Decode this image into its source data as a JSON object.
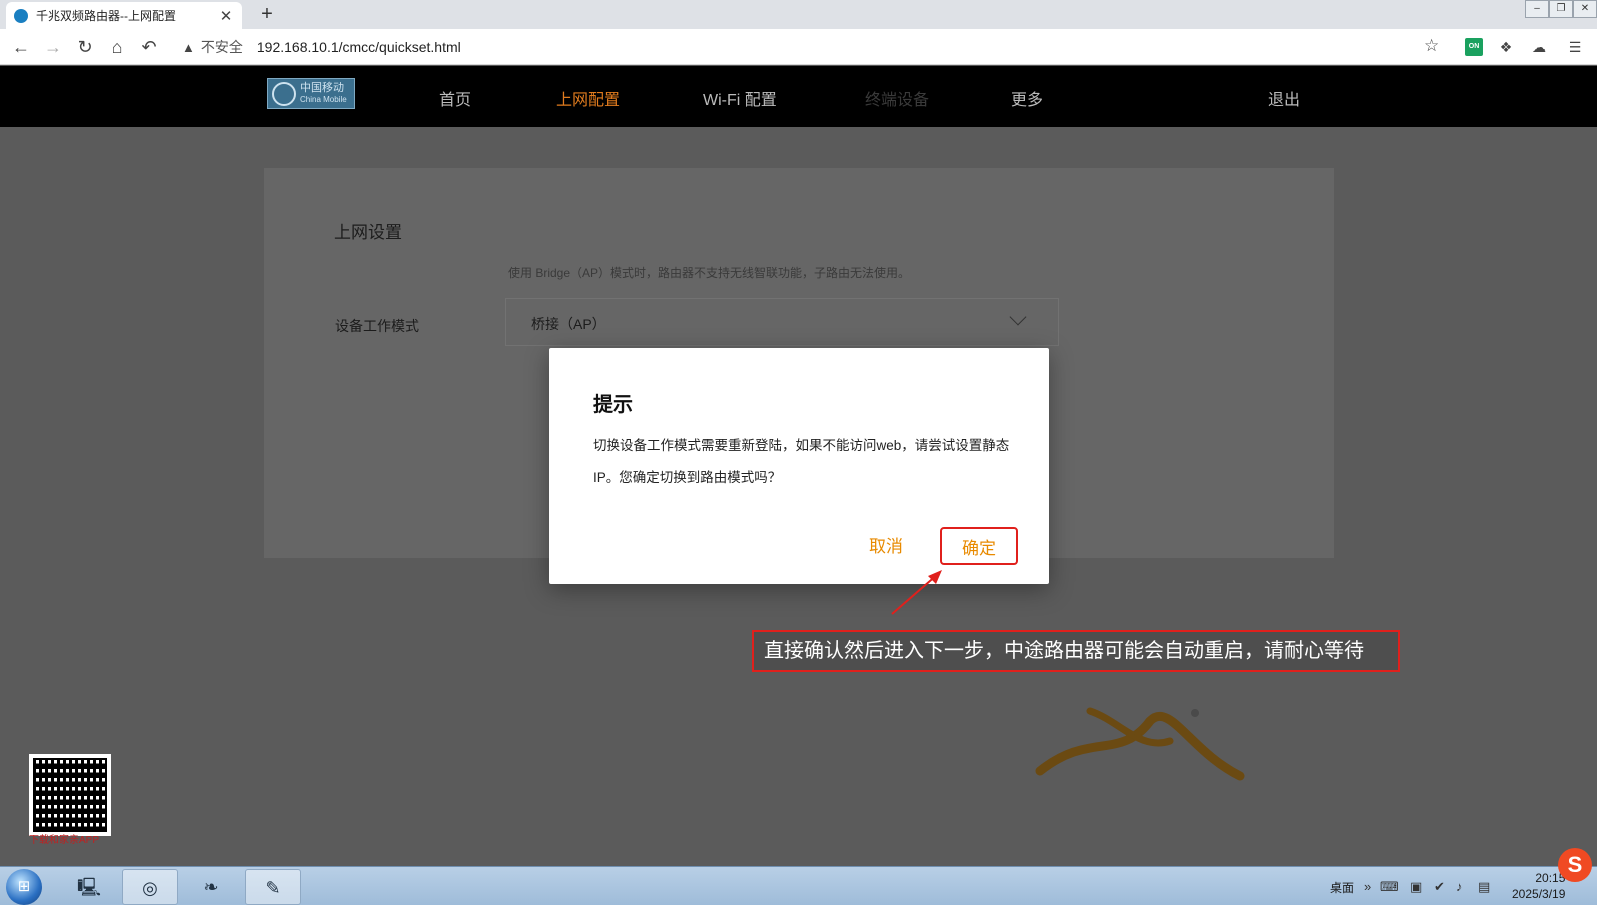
{
  "browser": {
    "tab_title": "千兆双频路由器--上网配置",
    "tab_close": "✕",
    "new_tab": "+",
    "security_label": "不安全",
    "url": "192.168.10.1/cmcc/quickset.html",
    "ext_on_label": "ON",
    "icons": [
      "back-icon",
      "forward-icon",
      "reload-icon",
      "home-icon",
      "undo-icon",
      "warning-icon",
      "star-icon",
      "extensions-icon",
      "download-icon",
      "menu-icon"
    ]
  },
  "router": {
    "logo_text": "中国移动",
    "logo_en": "China Mobile",
    "nav": [
      {
        "label": "首页"
      },
      {
        "label": "上网配置"
      },
      {
        "label": "Wi-Fi 配置"
      },
      {
        "label": "终端设备"
      },
      {
        "label": "更多"
      },
      {
        "label": "退出"
      }
    ],
    "active_nav": "上网配置",
    "section_title": "上网设置",
    "hint": "使用 Bridge（AP）模式时，路由器不支持无线智联功能，子路由无法使用。",
    "field_label": "设备工作模式",
    "select_value": "桥接（AP）",
    "qr_caption": "下载和家亲APP"
  },
  "modal": {
    "title": "提示",
    "message": "切换设备工作模式需要重新登陆，如果不能访问web，请尝试设置静态IP。您确定切换到路由模式吗？",
    "cancel_label": "取消",
    "ok_label": "确定"
  },
  "annotation": {
    "text": "直接确认然后进入下一步，中途路由器可能会自动重启，请耐心等待"
  },
  "taskbar": {
    "desktop_label": "桌面",
    "time": "20:15",
    "date": "2025/3/19"
  },
  "colors": {
    "accent": "#e07b1e",
    "button_text": "#e88a00",
    "highlight_border": "#e0201c"
  }
}
